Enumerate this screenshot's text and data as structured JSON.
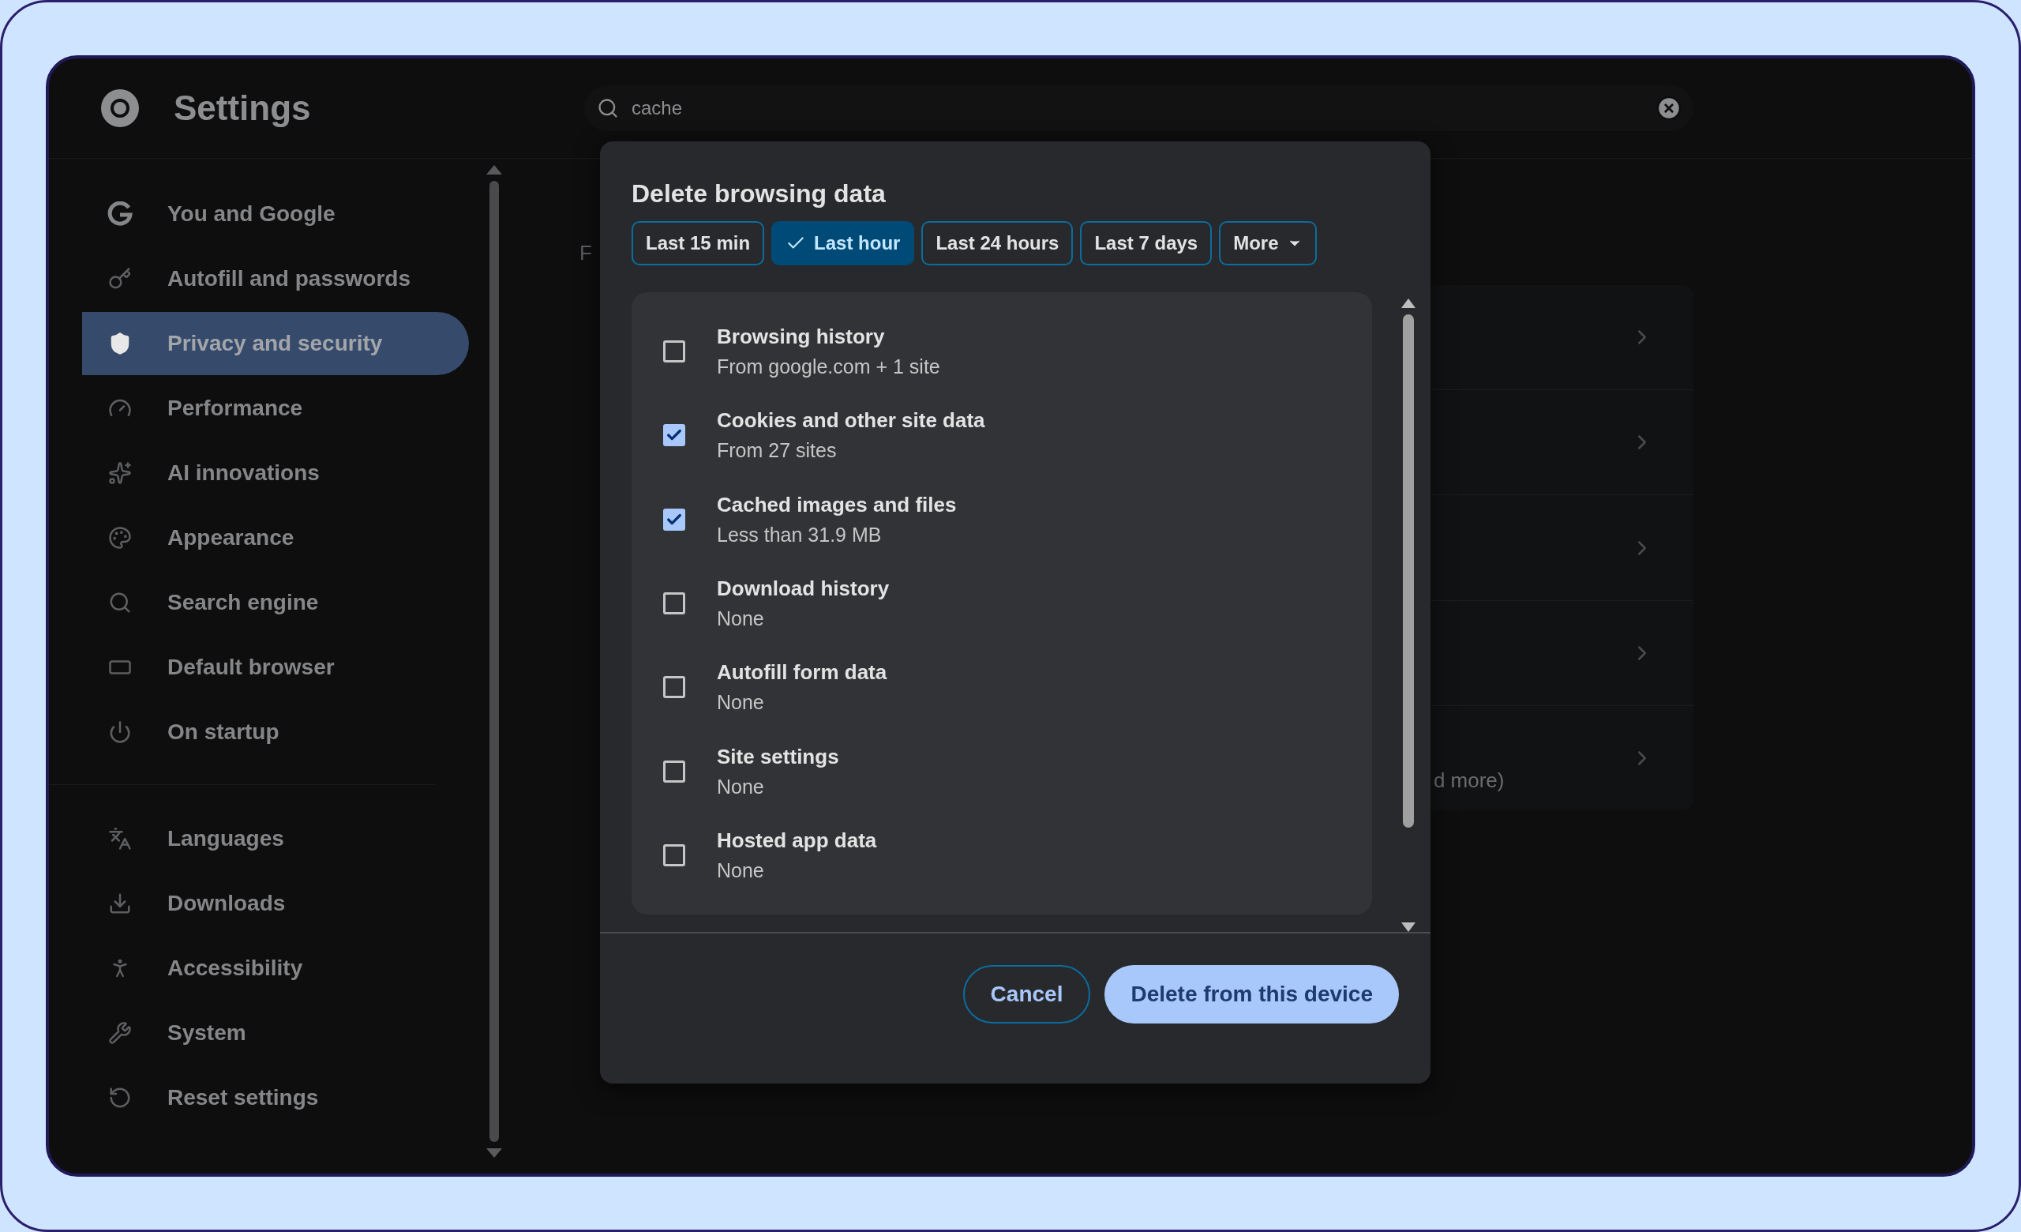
{
  "header": {
    "title": "Settings"
  },
  "search": {
    "value": "cache"
  },
  "sidebar": {
    "groups": [
      [
        {
          "label": "You and Google",
          "selected": false
        },
        {
          "label": "Autofill and passwords",
          "selected": false
        },
        {
          "label": "Privacy and security",
          "selected": true
        },
        {
          "label": "Performance",
          "selected": false
        },
        {
          "label": "AI innovations",
          "selected": false
        },
        {
          "label": "Appearance",
          "selected": false
        },
        {
          "label": "Search engine",
          "selected": false
        },
        {
          "label": "Default browser",
          "selected": false
        },
        {
          "label": "On startup",
          "selected": false
        }
      ],
      [
        {
          "label": "Languages",
          "selected": false
        },
        {
          "label": "Downloads",
          "selected": false
        },
        {
          "label": "Accessibility",
          "selected": false
        },
        {
          "label": "System",
          "selected": false
        },
        {
          "label": "Reset settings",
          "selected": false
        }
      ]
    ]
  },
  "background": {
    "heading_fragment": "F",
    "last_row_text": "d more)"
  },
  "dialog": {
    "title": "Delete browsing data",
    "chips": [
      {
        "label": "Last 15 min",
        "selected": false,
        "kind": "chip"
      },
      {
        "label": "Last hour",
        "selected": true,
        "kind": "chip"
      },
      {
        "label": "Last 24 hours",
        "selected": false,
        "kind": "chip"
      },
      {
        "label": "Last 7 days",
        "selected": false,
        "kind": "chip"
      },
      {
        "label": "More",
        "selected": false,
        "kind": "dropdown"
      }
    ],
    "items": [
      {
        "label": "Browsing history",
        "detail": "From google.com + 1 site",
        "checked": false
      },
      {
        "label": "Cookies and other site data",
        "detail": "From 27 sites",
        "checked": true
      },
      {
        "label": "Cached images and files",
        "detail": "Less than 31.9 MB",
        "checked": true
      },
      {
        "label": "Download history",
        "detail": "None",
        "checked": false
      },
      {
        "label": "Autofill form data",
        "detail": "None",
        "checked": false
      },
      {
        "label": "Site settings",
        "detail": "None",
        "checked": false
      },
      {
        "label": "Hosted app data",
        "detail": "None",
        "checked": false
      }
    ],
    "buttons": [
      {
        "label": "Cancel",
        "kind": "outline"
      },
      {
        "label": "Delete from this device",
        "kind": "filled"
      }
    ]
  }
}
